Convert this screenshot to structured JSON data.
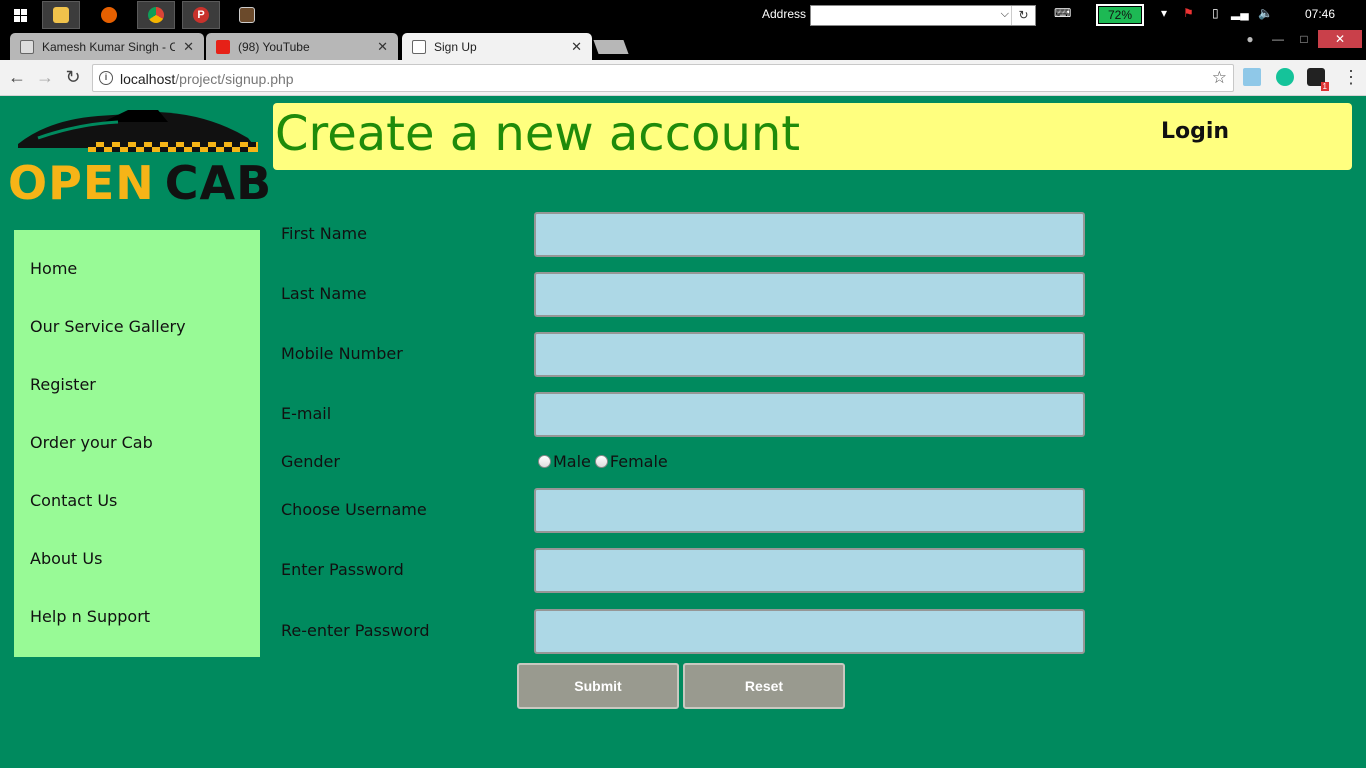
{
  "taskbar": {
    "address_label": "Address",
    "address_value": "",
    "battery_percent": "72%",
    "clock": "07:46"
  },
  "browser": {
    "tabs": [
      {
        "title": "Kamesh Kumar Singh - C",
        "close": "✕",
        "favicon_color": "#888888"
      },
      {
        "title": "(98) YouTube",
        "close": "✕",
        "favicon_color": "#e62117"
      },
      {
        "title": "Sign Up",
        "close": "✕",
        "favicon_color": "#888888"
      }
    ],
    "url_host": "localhost",
    "url_path": "/project/signup.php",
    "extension_badge": "1"
  },
  "page": {
    "logo": {
      "word1": "OPEN",
      "word2": "CAB"
    },
    "header_title": "Create a new account",
    "login_link": "Login",
    "nav": [
      "Home",
      "Our Service Gallery",
      "Register",
      "Order your Cab",
      "Contact Us",
      "About Us",
      "Help n Support"
    ],
    "form": {
      "first_name": "First Name",
      "last_name": "Last Name",
      "mobile": "Mobile Number",
      "email": "E-mail",
      "gender": "Gender",
      "gender_options": [
        "Male",
        "Female"
      ],
      "username": "Choose Username",
      "password": "Enter Password",
      "password_confirm": "Re-enter Password"
    },
    "buttons": {
      "submit": "Submit",
      "reset": "Reset"
    },
    "colors": {
      "page_bg": "#008a5e",
      "header_bg": "#ffff7f",
      "title_color": "#1f8b0a",
      "sidebar_bg": "#98fa96",
      "input_bg": "#add8e6",
      "button_bg": "#999a8f",
      "logo_yellow": "#f6b417"
    }
  }
}
